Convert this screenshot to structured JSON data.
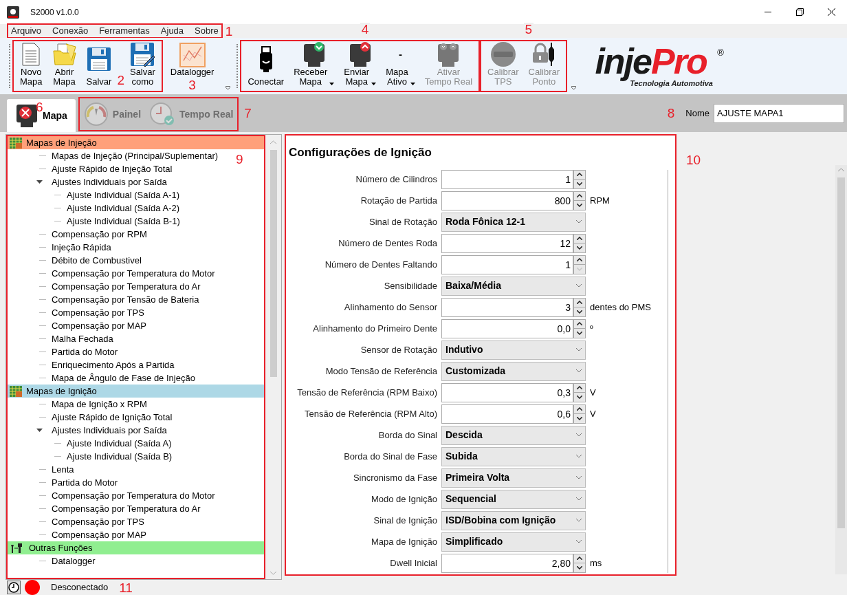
{
  "window": {
    "title": "S2000 v1.0.0"
  },
  "menu": {
    "annotation": "1",
    "items": [
      "Arquivo",
      "Conexão",
      "Ferramentas",
      "Ajuda",
      "Sobre"
    ]
  },
  "toolbar": {
    "groups": [
      {
        "annotation": "2",
        "buttons": [
          {
            "label": "Novo\nMapa",
            "dropdown": false,
            "disabled": false
          },
          {
            "label": "Abrir\nMapa",
            "dropdown": false,
            "disabled": false
          },
          {
            "label": "Salvar",
            "dropdown": false,
            "disabled": false
          },
          {
            "label": "Salvar\ncomo",
            "dropdown": false,
            "disabled": false
          }
        ]
      },
      {
        "annotation": "3",
        "buttons": [
          {
            "label": "Datalogger",
            "dropdown": false,
            "disabled": false
          }
        ]
      },
      {
        "annotation": "4",
        "buttons": [
          {
            "label": "Conectar",
            "dropdown": false,
            "disabled": false
          },
          {
            "label": "Receber\nMapa",
            "dropdown": true,
            "disabled": false
          },
          {
            "label": "Enviar\nMapa",
            "dropdown": true,
            "disabled": false
          },
          {
            "label": "Mapa\nAtivo",
            "value": "-",
            "dropdown": true,
            "disabled": false
          },
          {
            "label": "Ativar\nTempo Real",
            "dropdown": false,
            "disabled": true
          }
        ]
      },
      {
        "annotation": "5",
        "buttons": [
          {
            "label": "Calibrar\nTPS",
            "dropdown": false,
            "disabled": true
          },
          {
            "label": "Calibrar\nPonto",
            "dropdown": false,
            "disabled": true
          }
        ]
      }
    ]
  },
  "logo": {
    "brand_a": "inje",
    "brand_b": "Pro",
    "tagline": "Tecnologia Automotiva",
    "mark": "®"
  },
  "tabs": {
    "annotation": "7",
    "items": [
      {
        "label": "Mapa",
        "selected": true,
        "disabled": false,
        "annotation": "6"
      },
      {
        "label": "Painel",
        "selected": false,
        "disabled": true
      },
      {
        "label": "Tempo Real",
        "selected": false,
        "disabled": true
      }
    ]
  },
  "name_field": {
    "annotation": "8",
    "label": "Nome",
    "value": "AJUSTE MAPA1"
  },
  "tree": {
    "annotation": "9",
    "sections": [
      {
        "label": "Mapas de Injeção",
        "color": "#ffa07a",
        "items": [
          {
            "label": "Mapas de Injeção (Principal/Suplementar)"
          },
          {
            "label": "Ajuste Rápido de Injeção Total"
          },
          {
            "label": "Ajustes Individuais por Saída",
            "expanded": true,
            "children": [
              {
                "label": "Ajuste Individual (Saída A-1)"
              },
              {
                "label": "Ajuste Individual (Saída A-2)"
              },
              {
                "label": "Ajuste Individual (Saída B-1)"
              }
            ]
          },
          {
            "label": "Compensação por RPM"
          },
          {
            "label": "Injeção Rápida"
          },
          {
            "label": "Débito de Combustivel"
          },
          {
            "label": "Compensação por Temperatura do Motor"
          },
          {
            "label": "Compensação por Temperatura do Ar"
          },
          {
            "label": "Compensação por Tensão de Bateria"
          },
          {
            "label": "Compensação por TPS"
          },
          {
            "label": "Compensação por MAP"
          },
          {
            "label": "Malha Fechada"
          },
          {
            "label": "Partida do Motor"
          },
          {
            "label": "Enriquecimento Após a Partida"
          },
          {
            "label": "Mapa de Ângulo de Fase de Injeção"
          }
        ]
      },
      {
        "label": "Mapas de Ignição",
        "color": "#add8e6",
        "items": [
          {
            "label": "Mapa de Ignição x RPM"
          },
          {
            "label": "Ajuste Rápido de Ignição Total"
          },
          {
            "label": "Ajustes Individuais por Saída",
            "expanded": true,
            "children": [
              {
                "label": "Ajuste Individual (Saída A)"
              },
              {
                "label": "Ajuste Individual (Saída B)"
              }
            ]
          },
          {
            "label": "Lenta"
          },
          {
            "label": "Partida do Motor"
          },
          {
            "label": "Compensação por Temperatura do Motor"
          },
          {
            "label": "Compensação por Temperatura do Ar"
          },
          {
            "label": "Compensação por TPS"
          },
          {
            "label": "Compensação por MAP"
          }
        ]
      },
      {
        "label": "Outras Funções",
        "color": "#90ee90",
        "items": [
          {
            "label": "Datalogger"
          }
        ]
      }
    ]
  },
  "form": {
    "annotation": "10",
    "title": "Configurações de Ignição",
    "fields": [
      {
        "kind": "spin",
        "label": "Número de Cilindros",
        "value": "1",
        "down_disabled": false
      },
      {
        "kind": "spin",
        "label": "Rotação de Partida",
        "value": "800",
        "unit": "RPM",
        "down_disabled": false
      },
      {
        "kind": "select",
        "label": "Sinal de Rotação",
        "value": "Roda Fônica 12-1"
      },
      {
        "kind": "spin",
        "label": "Número de Dentes Roda",
        "value": "12",
        "down_disabled": false
      },
      {
        "kind": "spin",
        "label": "Número de Dentes Faltando",
        "value": "1",
        "down_disabled": true
      },
      {
        "kind": "select",
        "label": "Sensibilidade",
        "value": "Baixa/Média"
      },
      {
        "kind": "spin",
        "label": "Alinhamento do Sensor",
        "value": "3",
        "unit": "dentes do PMS",
        "down_disabled": false
      },
      {
        "kind": "spin",
        "label": "Alinhamento do Primeiro Dente",
        "value": "0,0",
        "unit": "º",
        "down_disabled": false
      },
      {
        "kind": "select",
        "label": "Sensor de Rotação",
        "value": "Indutivo"
      },
      {
        "kind": "select",
        "label": "Modo Tensão de Referência",
        "value": "Customizada"
      },
      {
        "kind": "spin",
        "label": "Tensão de Referência (RPM Baixo)",
        "value": "0,3",
        "unit": "V",
        "down_disabled": false
      },
      {
        "kind": "spin",
        "label": "Tensão de Referência (RPM Alto)",
        "value": "0,6",
        "unit": "V",
        "down_disabled": false
      },
      {
        "kind": "select",
        "label": "Borda do Sinal",
        "value": "Descida"
      },
      {
        "kind": "select",
        "label": "Borda do Sinal de Fase",
        "value": "Subida"
      },
      {
        "kind": "select",
        "label": "Sincronismo da Fase",
        "value": "Primeira Volta"
      },
      {
        "kind": "select",
        "label": "Modo de Ignição",
        "value": "Sequencial"
      },
      {
        "kind": "select",
        "label": "Sinal de Ignição",
        "value": "ISD/Bobina com Ignição"
      },
      {
        "kind": "select",
        "label": "Mapa de Ignição",
        "value": "Simplificado"
      },
      {
        "kind": "spin",
        "label": "Dwell Inicial",
        "value": "2,80",
        "unit": "ms",
        "down_disabled": false
      }
    ]
  },
  "status_bar": {
    "annotation": "11",
    "connected": false,
    "text": "Desconectado"
  }
}
